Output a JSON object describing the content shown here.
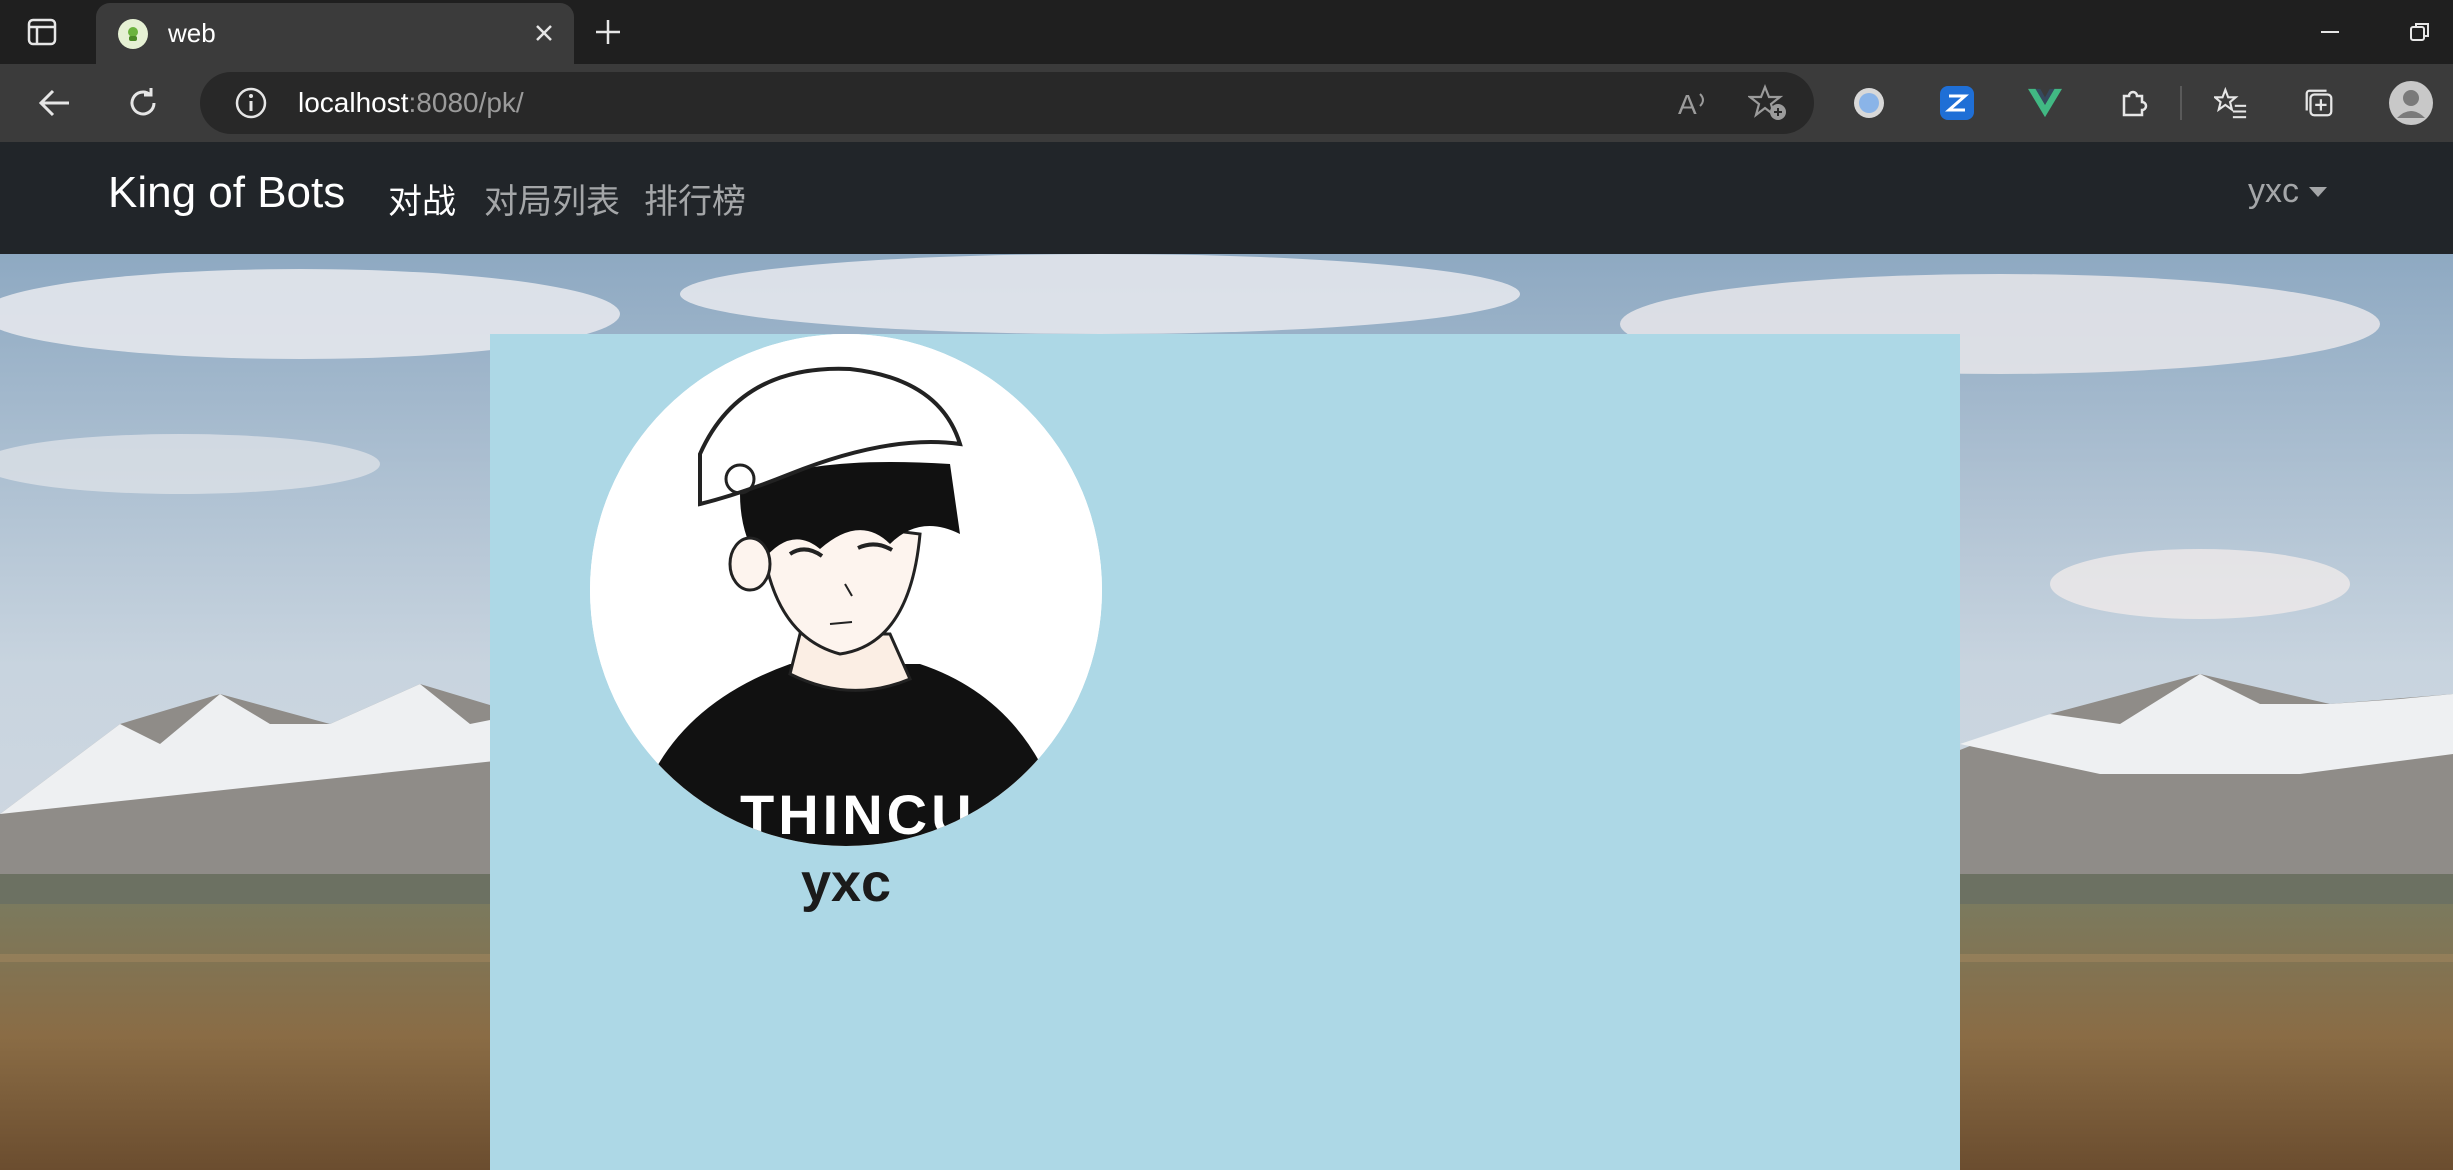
{
  "browser": {
    "tab_title": "web",
    "url_host": "localhost",
    "url_rest": ":8080/pk/"
  },
  "site": {
    "brand": "King of Bots",
    "nav": [
      {
        "label": "对战",
        "active": true
      },
      {
        "label": "对局列表",
        "active": false
      },
      {
        "label": "排行榜",
        "active": false
      }
    ],
    "user_menu": "yxc"
  },
  "profile": {
    "username": "yxc"
  },
  "colors": {
    "navbar_bg": "#212529",
    "card_bg": "#add8e6",
    "nav_active": "#ffffff",
    "nav_inactive": "#a4a6a8"
  },
  "icons": [
    "tab-actions-icon",
    "favicon-icon",
    "close-icon",
    "plus-icon",
    "minimize-icon",
    "restore-icon",
    "back-icon",
    "reload-icon",
    "info-icon",
    "read-aloud-icon",
    "add-favorite-icon",
    "extension-icon",
    "favorites-icon",
    "collections-icon",
    "profile-icon"
  ]
}
